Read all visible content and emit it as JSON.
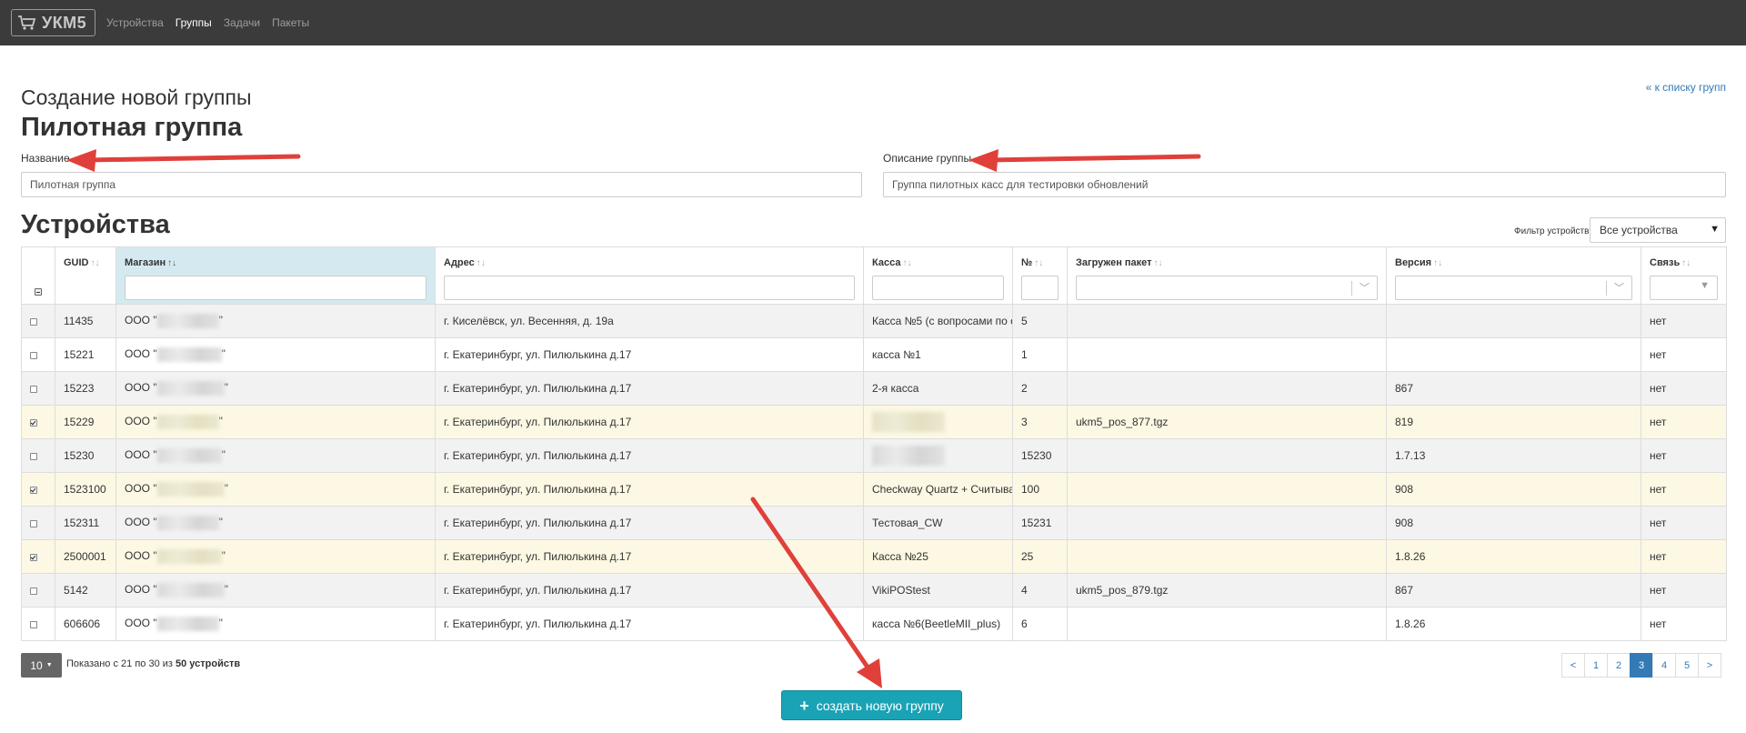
{
  "navbar": {
    "logo_text": "УКМ5",
    "links": [
      {
        "label": "Устройства",
        "active": false
      },
      {
        "label": "Группы",
        "active": true
      },
      {
        "label": "Задачи",
        "active": false
      },
      {
        "label": "Пакеты",
        "active": false
      }
    ]
  },
  "page": {
    "subtitle": "Создание новой группы",
    "title": "Пилотная группа",
    "back_link": "« к списку групп"
  },
  "form": {
    "name_label": "Название",
    "name_value": "Пилотная группа",
    "desc_label": "Описание группы",
    "desc_value": "Группа пилотных касс для тестировки обновлений"
  },
  "devices": {
    "section_title": "Устройства",
    "filter_label": "Фильтр устройств:",
    "filter_value": "Все устройства",
    "columns": [
      "GUID",
      "Магазин",
      "Адрес",
      "Касса",
      "№",
      "Загружен пакет",
      "Версия",
      "Связь"
    ],
    "sort_icon": "↑↓",
    "rows": [
      {
        "checked": false,
        "guid": "11435",
        "shop": "ООО \"",
        "shop_end": "\"",
        "address": "г. Киселёвск, ул. Весенняя, д. 19а",
        "kassa": "Касса №5 (с вопросами по о",
        "kassa_blur": false,
        "num": "5",
        "package": "",
        "version": "",
        "link": "нет"
      },
      {
        "checked": false,
        "guid": "15221",
        "shop": "ООО \"",
        "shop_end": "\"",
        "address": "г. Екатеринбург, ул. Пилюлькина д.17",
        "kassa": "касса №1",
        "kassa_blur": false,
        "num": "1",
        "package": "",
        "version": "",
        "link": "нет"
      },
      {
        "checked": false,
        "guid": "15223",
        "shop": "ООО \"",
        "shop_end": "\"",
        "address": "г. Екатеринбург, ул. Пилюлькина д.17",
        "kassa": "2-я касса",
        "kassa_blur": false,
        "num": "2",
        "package": "",
        "version": "867",
        "link": "нет"
      },
      {
        "checked": true,
        "guid": "15229",
        "shop": "ООО \"",
        "shop_end": "\"",
        "address": "г. Екатеринбург, ул. Пилюлькина д.17",
        "kassa": "",
        "kassa_blur": true,
        "num": "3",
        "package": "ukm5_pos_877.tgz",
        "version": "819",
        "link": "нет"
      },
      {
        "checked": false,
        "guid": "15230",
        "shop": "ООО \"",
        "shop_end": "\"",
        "address": "г. Екатеринбург, ул. Пилюлькина д.17",
        "kassa": "",
        "kassa_blur": true,
        "num": "15230",
        "package": "",
        "version": "1.7.13",
        "link": "нет"
      },
      {
        "checked": true,
        "guid": "1523100",
        "shop": "ООО \"",
        "shop_end": "\"",
        "address": "г. Екатеринбург, ул. Пилюлькина д.17",
        "kassa": "Checkway Quartz + Считыва",
        "kassa_blur": false,
        "num": "100",
        "package": "",
        "version": "908",
        "link": "нет"
      },
      {
        "checked": false,
        "guid": "152311",
        "shop": "ООО \"",
        "shop_end": "\"",
        "address": "г. Екатеринбург, ул. Пилюлькина д.17",
        "kassa": "Тестовая_CW",
        "kassa_blur": false,
        "num": "15231",
        "package": "",
        "version": "908",
        "link": "нет"
      },
      {
        "checked": true,
        "guid": "2500001",
        "shop": "ООО \"",
        "shop_end": "\"",
        "address": "г. Екатеринбург, ул. Пилюлькина д.17",
        "kassa": "Касса №25",
        "kassa_blur": false,
        "num": "25",
        "package": "",
        "version": "1.8.26",
        "link": "нет"
      },
      {
        "checked": false,
        "guid": "5142",
        "shop": "ООО \"",
        "shop_end": "\"",
        "address": "г. Екатеринбург, ул. Пилюлькина д.17",
        "kassa": "VikiPOStest",
        "kassa_blur": false,
        "num": "4",
        "package": "ukm5_pos_879.tgz",
        "version": "867",
        "link": "нет"
      },
      {
        "checked": false,
        "guid": "606606",
        "shop": "ООО \"",
        "shop_end": "\"",
        "address": "г. Екатеринбург, ул. Пилюлькина д.17",
        "kassa": "касса №6(BeetleMII_plus)",
        "kassa_blur": false,
        "num": "6",
        "package": "",
        "version": "1.8.26",
        "link": "нет"
      }
    ]
  },
  "pager": {
    "page_size": "10",
    "info_prefix": "Показано с 21 по 30 из ",
    "info_total": "50 устройств",
    "pages": [
      "<",
      "1",
      "2",
      "3",
      "4",
      "5",
      ">"
    ],
    "active_page": "3"
  },
  "create_button": {
    "label": "создать новую группу"
  },
  "colors": {
    "navbar": "#3b3b3b",
    "accent": "#1aa2b5",
    "link": "#337ab7",
    "annotation": "#e0403a",
    "selected_row": "#fcf8e3"
  }
}
